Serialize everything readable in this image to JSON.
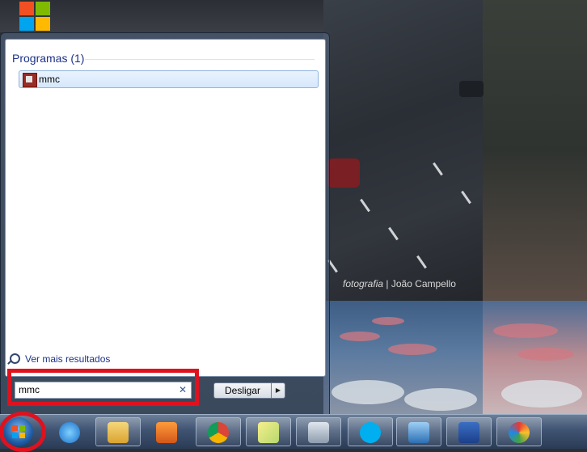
{
  "start_menu": {
    "group_title": "Programas (1)",
    "results": [
      {
        "label": "mmc",
        "icon": "mmc-console-icon"
      }
    ],
    "see_more_label": "Ver mais resultados",
    "search": {
      "value": "mmc",
      "clear_icon": "✕"
    },
    "shutdown_label": "Desligar",
    "shutdown_arrow": "▶"
  },
  "desktop": {
    "watermark_italic": "fotografia",
    "watermark_name": "| João Campello"
  },
  "taskbar": {
    "items": [
      {
        "name": "internet-explorer-icon"
      },
      {
        "name": "file-explorer-icon"
      },
      {
        "name": "media-player-icon"
      },
      {
        "name": "chrome-icon"
      },
      {
        "name": "sticky-notes-icon"
      },
      {
        "name": "calculator-icon"
      },
      {
        "name": "skype-icon"
      },
      {
        "name": "remote-desktop-icon"
      },
      {
        "name": "word-icon"
      },
      {
        "name": "paint-icon"
      }
    ]
  },
  "colors": {
    "highlight": "#e0111e",
    "group_title": "#1e3287"
  }
}
